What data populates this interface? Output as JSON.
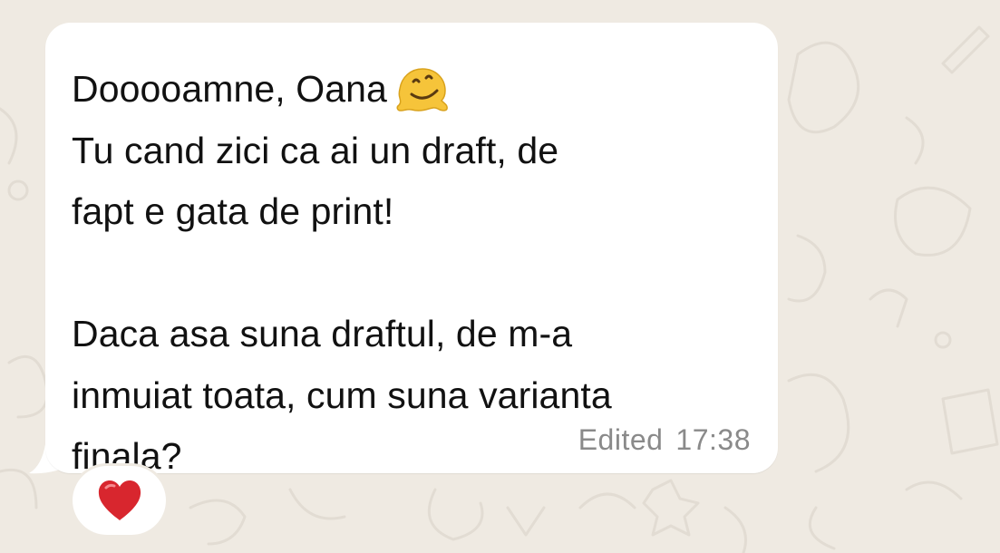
{
  "message": {
    "lines": [
      "Dooooamne, Oana",
      "Tu cand zici ca ai un draft, de",
      "fapt e gata de print!",
      "",
      "Daca asa suna draftul, de m-a",
      "inmuiat toata, cum suna varianta",
      "finala?"
    ],
    "emoji": "melting-face-icon",
    "edited_label": "Edited",
    "time": "17:38"
  },
  "reaction": {
    "emoji": "red-heart-icon"
  },
  "colors": {
    "background": "#efeae2",
    "bubble": "#ffffff",
    "text": "#111111",
    "meta": "#8a8a8a",
    "heart": "#d8262e",
    "emoji": "#f6c43a"
  }
}
